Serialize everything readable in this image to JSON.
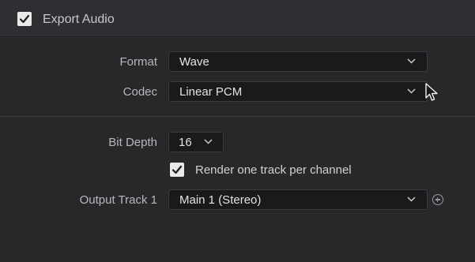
{
  "header": {
    "title": "Export Audio",
    "checked": true
  },
  "format": {
    "label": "Format",
    "value": "Wave"
  },
  "codec": {
    "label": "Codec",
    "value": "Linear PCM"
  },
  "bit_depth": {
    "label": "Bit Depth",
    "value": "16"
  },
  "render_option": {
    "label": "Render one track per channel",
    "checked": true
  },
  "output_track": {
    "label": "Output Track 1",
    "value": "Main 1 (Stereo)"
  },
  "icons": {
    "add": "plus-circle-icon",
    "dropdown": "chevron-down-icon",
    "pointer": "mouse-pointer-icon"
  }
}
